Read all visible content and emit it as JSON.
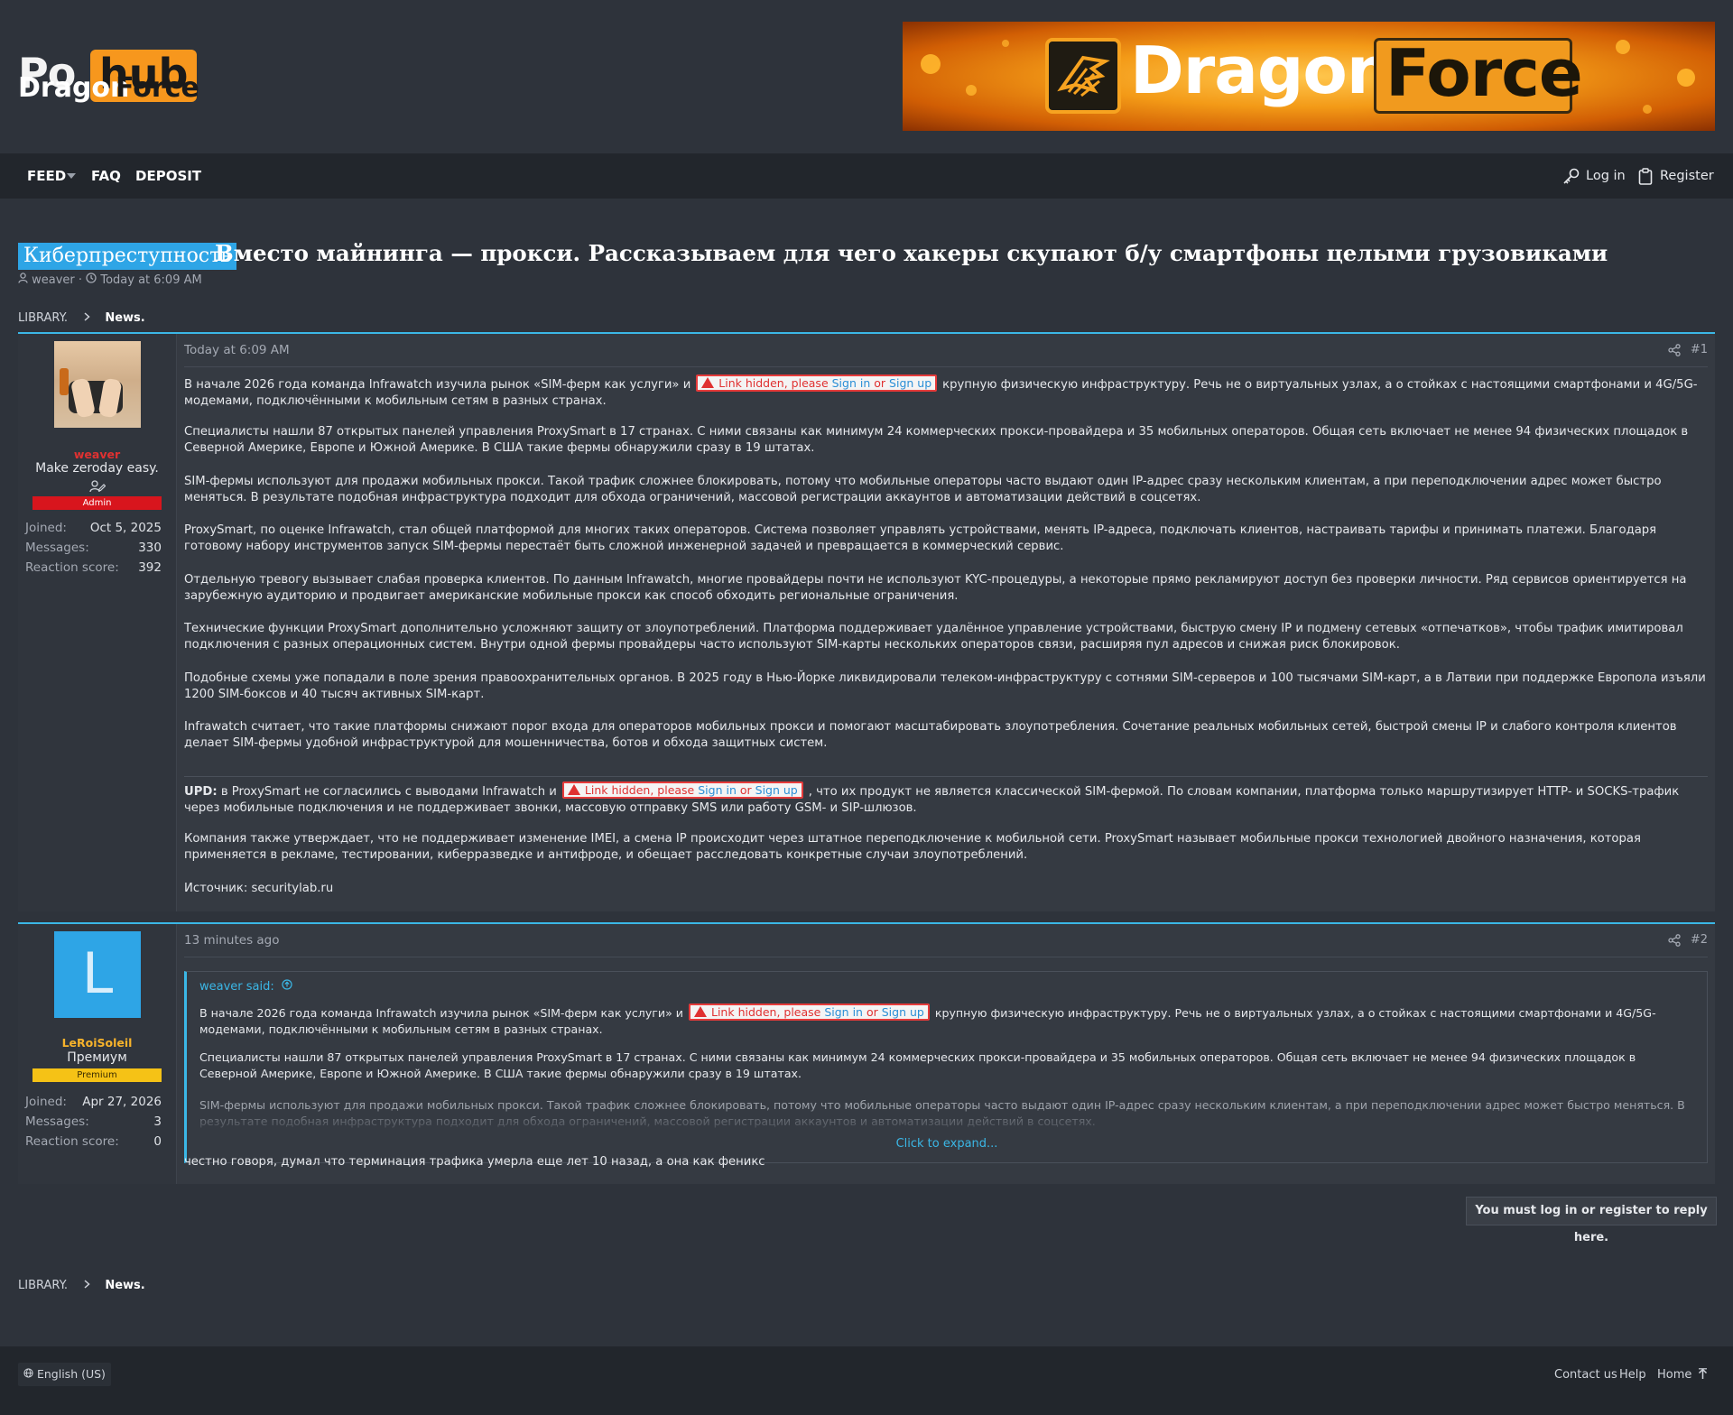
{
  "site": {
    "logo_ghost_a": "Po",
    "logo_ghost_b": "hub",
    "logo_word1": "Dragon",
    "logo_word2": "Force",
    "banner_word1": "Dragon",
    "banner_word2": "Force",
    "brand_orange": "#f7971d",
    "accent_blue": "#3bb7e6"
  },
  "nav": {
    "feed": "FEED",
    "faq": "FAQ",
    "deposit": "DEPOSIT",
    "login": "Log in",
    "register": "Register"
  },
  "thread": {
    "prefix": "Киберпреступность",
    "title": "Вместо майнинга — прокси. Рассказываем для чего хакеры скупают б/у смартфоны целыми грузовиками",
    "author": "weaver",
    "date": "Today at 6:09 AM",
    "sep": "·"
  },
  "breadcrumb": {
    "library": "LIBRARY.",
    "news": "News."
  },
  "hidden_link": {
    "text": "Link hidden, please",
    "sign_in": "Sign in",
    "or": "or",
    "sign_up": "Sign up"
  },
  "post1": {
    "user": {
      "name": "weaver",
      "title": "Make zeroday easy.",
      "banner": "Admin",
      "joined_label": "Joined:",
      "joined": "Oct 5, 2025",
      "messages_label": "Messages:",
      "messages": "330",
      "reaction_label": "Reaction score:",
      "reaction": "392"
    },
    "date": "Today at 6:09 AM",
    "number": "#1",
    "p1a": "В начале 2026 года команда Infrawatch изучила рынок «SIM-ферм как услуги» и",
    "p1b": "крупную физическую инфраструктуру. Речь не о виртуальных узлах, а о стойках с настоящими смартфонами и 4G/5G-модемами, подключёнными к мобильным сетям в разных странах.",
    "p2": "Специалисты нашли 87 открытых панелей управления ProxySmart в 17 странах. С ними связаны как минимум 24 коммерческих прокси-провайдера и 35 мобильных операторов. Общая сеть включает не менее 94 физических площадок в Северной Америке, Европе и Южной Америке. В США такие фермы обнаружили сразу в 19 штатах.",
    "p3": "SIM-фермы используют для продажи мобильных прокси. Такой трафик сложнее блокировать, потому что мобильные операторы часто выдают один IP-адрес сразу нескольким клиентам, а при переподключении адрес может быстро меняться. В результате подобная инфраструктура подходит для обхода ограничений, массовой регистрации аккаунтов и автоматизации действий в соцсетях.",
    "p4": "ProxySmart, по оценке Infrawatch, стал общей платформой для многих таких операторов. Система позволяет управлять устройствами, менять IP-адреса, подключать клиентов, настраивать тарифы и принимать платежи. Благодаря готовому набору инструментов запуск SIM-фермы перестаёт быть сложной инженерной задачей и превращается в коммерческий сервис.",
    "p5": "Отдельную тревогу вызывает слабая проверка клиентов. По данным Infrawatch, многие провайдеры почти не используют KYC-процедуры, а некоторые прямо рекламируют доступ без проверки личности. Ряд сервисов ориентируется на зарубежную аудиторию и продвигает американские мобильные прокси как способ обходить региональные ограничения.",
    "p6": "Технические функции ProxySmart дополнительно усложняют защиту от злоупотреблений. Платформа поддерживает удалённое управление устройствами, быструю смену IP и подмену сетевых «отпечатков», чтобы трафик имитировал подключения с разных операционных систем. Внутри одной фермы провайдеры часто используют SIM-карты нескольких операторов связи, расширяя пул адресов и снижая риск блокировок.",
    "p7": "Подобные схемы уже попадали в поле зрения правоохранительных органов. В 2025 году в Нью-Йорке ликвидировали телеком-инфраструктуру с сотнями SIM-серверов и 100 тысячами SIM-карт, а в Латвии при поддержке Европола изъяли 1200 SIM-боксов и 40 тысяч активных SIM-карт.",
    "p8": "Infrawatch считает, что такие платформы снижают порог входа для операторов мобильных прокси и помогают масштабировать злоупотребления. Сочетание реальных мобильных сетей, быстрой смены IP и слабого контроля клиентов делает SIM-фермы удобной инфраструктурой для мошенничества, ботов и обхода защитных систем.",
    "upd_label": "UPD:",
    "upd_a": "в ProxySmart не согласились с выводами Infrawatch и",
    "upd_b": ", что их продукт не является классической SIM-фермой. По словам компании, платформа только маршрутизирует HTTP- и SOCKS-трафик через мобильные подключения и не поддерживает звонки, массовую отправку SMS или работу GSM- и SIP-шлюзов.",
    "p10": "Компания также утверждает, что не поддерживает изменение IMEI, а смена IP происходит через штатное переподключение к мобильной сети. ProxySmart называет мобильные прокси технологией двойного назначения, которая применяется в рекламе, тестировании, киберразведке и антифроде, и обещает расследовать конкретные случаи злоупотреблений.",
    "source": "Источник: securitylab.ru"
  },
  "post2": {
    "user": {
      "avatar_letter": "L",
      "name": "LeRoiSoleil",
      "title": "Премиум",
      "banner": "Premium",
      "joined_label": "Joined:",
      "joined": "Apr 27, 2026",
      "messages_label": "Messages:",
      "messages": "3",
      "reaction_label": "Reaction score:",
      "reaction": "0"
    },
    "date": "13 minutes ago",
    "number": "#2",
    "quote_author": "weaver said:",
    "q1a": "В начале 2026 года команда Infrawatch изучила рынок «SIM-ферм как услуги» и",
    "q1b": "крупную физическую инфраструктуру. Речь не о виртуальных узлах, а о стойках с настоящими смартфонами и 4G/5G-модемами, подключёнными к мобильным сетям в разных странах.",
    "q2": "Специалисты нашли 87 открытых панелей управления ProxySmart в 17 странах. С ними связаны как минимум 24 коммерческих прокси-провайдера и 35 мобильных операторов. Общая сеть включает не менее 94 физических площадок в Северной Америке, Европе и Южной Америке. В США такие фермы обнаружили сразу в 19 штатах.",
    "q3": "SIM-фермы используют для продажи мобильных прокси. Такой трафик сложнее блокировать, потому что мобильные операторы часто выдают один IP-адрес сразу нескольким клиентам, а при переподключении адрес может быстро меняться. В результате подобная инфраструктура подходит для обхода ограничений, массовой регистрации аккаунтов и автоматизации действий в соцсетях.",
    "expand": "Click to expand...",
    "body": "честно говоря, думал что терминация трафика умерла еще лет 10 назад, а она как феникс"
  },
  "reply_note": "You must log in or register to reply here.",
  "footer": {
    "language": "English (US)",
    "contact": "Contact us",
    "help": "Help",
    "home": "Home"
  }
}
